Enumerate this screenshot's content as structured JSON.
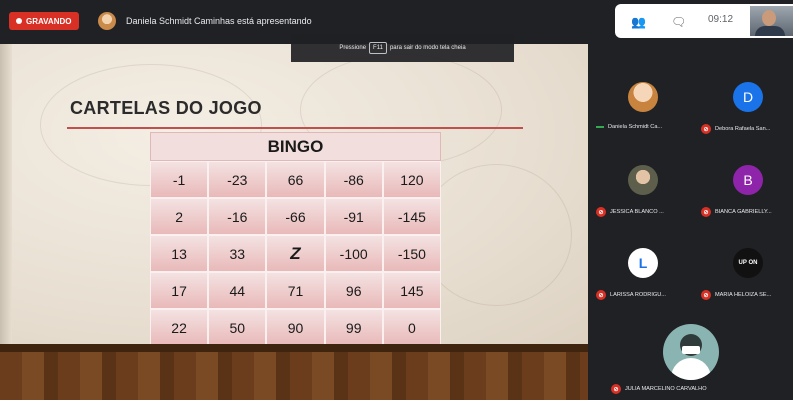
{
  "recording": {
    "label": "GRAVANDO"
  },
  "presenting": {
    "text": "Daniela Schmidt Caminhas está apresentando"
  },
  "fullscreen_hint": {
    "before": "Pressione",
    "key": "F11",
    "after": "para sair do modo tela cheia"
  },
  "toolbar": {
    "time": "09:12",
    "icons": [
      "people-icon",
      "chat-icon"
    ]
  },
  "slide": {
    "title": "CARTELAS DO JOGO",
    "bingo": {
      "header": "BINGO",
      "rows": [
        [
          "-1",
          "-23",
          "66",
          "-86",
          "120"
        ],
        [
          "2",
          "-16",
          "-66",
          "-91",
          "-145"
        ],
        [
          "13",
          "33",
          "Z",
          "-100",
          "-150"
        ],
        [
          "17",
          "44",
          "71",
          "96",
          "145"
        ],
        [
          "22",
          "50",
          "90",
          "99",
          "0"
        ]
      ]
    }
  },
  "participants": [
    {
      "name": "Daniela Schmidt Ca...",
      "initial": "",
      "color": "#e0a35c",
      "muted": false
    },
    {
      "name": "Debora Rafaela San...",
      "initial": "D",
      "color": "#1a73e8",
      "muted": true
    },
    {
      "name": "JESSICA BLANCO ...",
      "initial": "",
      "color": "#6d6f5a",
      "muted": true
    },
    {
      "name": "BIANCA GABRIELLY...",
      "initial": "B",
      "color": "#8e24aa",
      "muted": true
    },
    {
      "name": "LARISSA RODRIGU...",
      "initial": "L",
      "color": "#ffffff",
      "muted": true
    },
    {
      "name": "MARIA HELOIZA SE...",
      "initial": "UP ON",
      "color": "#111111",
      "muted": true
    },
    {
      "name": "JULIA MARCELINO CARVALHO",
      "initial": "",
      "color": "#8ab4b1",
      "muted": true
    }
  ]
}
